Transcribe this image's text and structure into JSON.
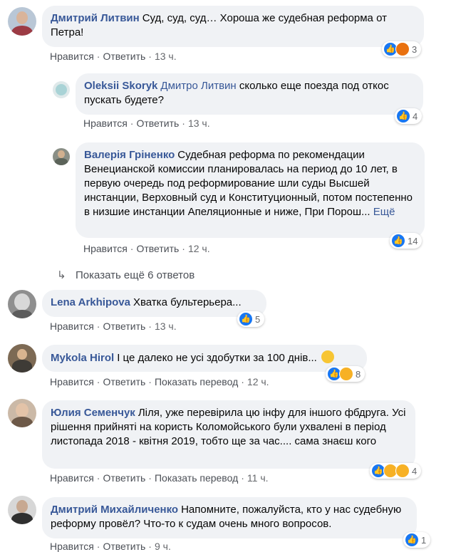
{
  "colors": {
    "author": "#385898",
    "bubble": "#f0f2f5",
    "like": "#1877f2",
    "muted": "#65676b"
  },
  "comments": [
    {
      "author": "Дмитрий Литвин",
      "text": "Суд, суд, суд… Хороша же судебная реформа от Петра!",
      "like": "Нравится",
      "reply": "Ответить",
      "time": "13 ч.",
      "reactions": "3",
      "icons": [
        "like-icon",
        "angry-icon"
      ]
    },
    {
      "author": "Oleksii Skoryk",
      "mention": "Дмитро Литвин",
      "text": "сколько еще поезда под откос пускать будете?",
      "like": "Нравится",
      "reply": "Ответить",
      "time": "13 ч.",
      "reactions": "4",
      "icons": [
        "like-icon"
      ]
    },
    {
      "author": "Валерія Гріненко",
      "text": "Судебная реформа по рекомендации Венецианской комиссии планировалась на период до 10 лет, в первую очередь под реформирование шли суды Высшей инстанции, Верховный суд и Конституционный, потом постепенно в низшие инстанции Апеляционные и ниже, При Порош...",
      "more": "Ещё",
      "like": "Нравится",
      "reply": "Ответить",
      "time": "12 ч.",
      "reactions": "14",
      "icons": [
        "like-icon"
      ]
    },
    {
      "author": "Lena Arkhipova",
      "text": "Хватка бультерьера...",
      "like": "Нравится",
      "reply": "Ответить",
      "time": "13 ч.",
      "reactions": "5",
      "icons": [
        "like-icon"
      ]
    },
    {
      "author": "Mykola Hirol",
      "text": "І це далеко не усі здобутки за 100 днів...",
      "like": "Нравится",
      "reply": "Ответить",
      "translate": "Показать перевод",
      "time": "12 ч.",
      "reactions": "8",
      "icons": [
        "like-icon",
        "sad-icon"
      ]
    },
    {
      "author": "Юлия Семенчук",
      "text": "Ліля, уже перевірила цю інфу для іншого фбдруга. Усі рішення прийняті на користь Коломойського були ухвалені в період листопада 2018 - квітня 2019, тобто ще за час.... сама знаєш кого",
      "like": "Нравится",
      "reply": "Ответить",
      "translate": "Показать перевод",
      "time": "11 ч.",
      "reactions": "4",
      "icons": [
        "like-icon",
        "wow-icon",
        "sad-icon"
      ]
    },
    {
      "author": "Дмитрий Михайличенко",
      "text": "Напомните, пожалуйста, кто у нас судебную реформу провёл? Что-то к судам очень много вопросов.",
      "like": "Нравится",
      "reply": "Ответить",
      "time": "9 ч.",
      "reactions": "1",
      "icons": [
        "like-icon"
      ]
    }
  ],
  "show_more_replies": "Показать ещё 6 ответов"
}
